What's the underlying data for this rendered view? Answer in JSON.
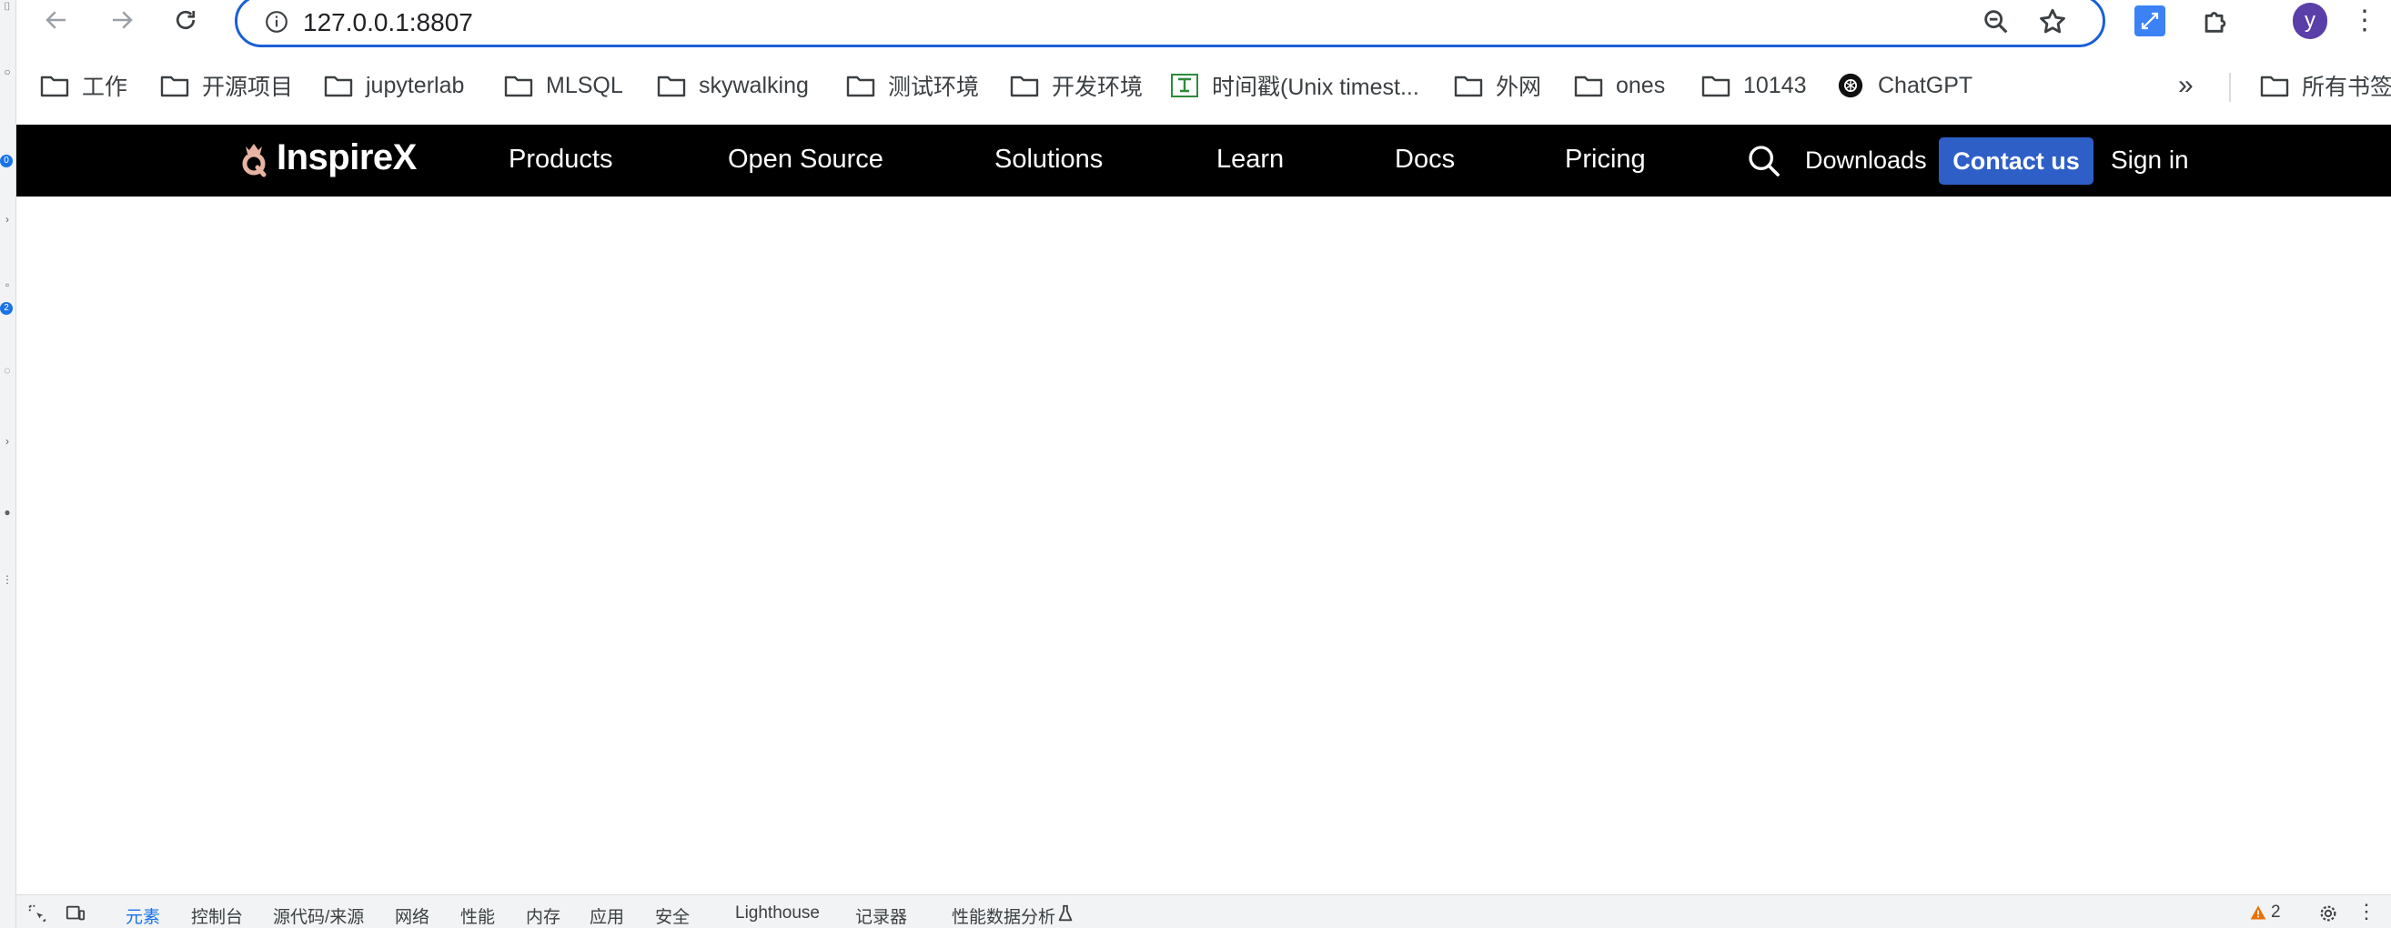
{
  "browser": {
    "url": "127.0.0.1:8807",
    "profile_initial": "y",
    "more_bookmarks": "»"
  },
  "bookmarks": [
    {
      "label": "工作",
      "icon": "folder-icon"
    },
    {
      "label": "开源项目",
      "icon": "folder-icon"
    },
    {
      "label": "jupyterlab",
      "icon": "folder-icon"
    },
    {
      "label": "MLSQL",
      "icon": "folder-icon"
    },
    {
      "label": "skywalking",
      "icon": "folder-icon"
    },
    {
      "label": "测试环境",
      "icon": "folder-icon"
    },
    {
      "label": "开发环境",
      "icon": "folder-icon"
    },
    {
      "label": "时间戳(Unix timest...",
      "icon": "timestamp-site-icon"
    },
    {
      "label": "外网",
      "icon": "folder-icon"
    },
    {
      "label": "ones",
      "icon": "folder-icon"
    },
    {
      "label": "10143",
      "icon": "folder-icon"
    },
    {
      "label": "ChatGPT",
      "icon": "chatgpt-icon"
    },
    {
      "label": "所有书签",
      "icon": "folder-icon"
    }
  ],
  "site": {
    "logo_text": "InspireX",
    "nav": [
      "Products",
      "Open Source",
      "Solutions",
      "Learn",
      "Docs",
      "Pricing"
    ],
    "downloads": "Downloads",
    "contact": "Contact us",
    "signin": "Sign in",
    "accent_color": "#2e5fc7"
  },
  "devtools": {
    "tabs": [
      "元素",
      "控制台",
      "源代码/来源",
      "网络",
      "性能",
      "内存",
      "应用",
      "安全",
      "Lighthouse",
      "记录器",
      "性能数据分析"
    ],
    "active_tab": "元素",
    "warning_count": "2"
  },
  "left_strip": {
    "badge_top": "0",
    "badge_bottom": "2"
  }
}
